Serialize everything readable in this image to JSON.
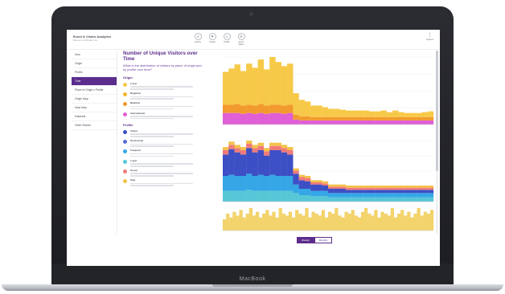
{
  "device": {
    "brand": "MacBook"
  },
  "app": {
    "title": "Event & Visitor Analytics",
    "subtitle": "Museum of Modern Art",
    "toolbar": [
      {
        "label": "History",
        "icon": "history-icon",
        "glyph": "↺"
      },
      {
        "label": "Origins",
        "icon": "flag-icon",
        "glyph": "⚑"
      },
      {
        "label": "Profile",
        "icon": "person-icon",
        "glyph": "♙"
      },
      {
        "label": "Event Matrix",
        "icon": "gear-icon",
        "glyph": "⚙"
      }
    ],
    "menu": {
      "label": "Options",
      "glyph": "⋮"
    }
  },
  "sidebar": {
    "items": [
      {
        "label": "Intro",
        "active": false
      },
      {
        "label": "Origin",
        "active": false
      },
      {
        "label": "Profile",
        "active": false
      },
      {
        "label": "Time",
        "active": true
      },
      {
        "label": "Place of Origin x Profile",
        "active": false
      },
      {
        "label": "Origin Map",
        "active": false
      },
      {
        "label": "Heat Map",
        "active": false
      },
      {
        "label": "Datasets",
        "active": false
      },
      {
        "label": "Other Stories",
        "active": false
      }
    ]
  },
  "content": {
    "title": "Number of Unique Visitors over Time",
    "question": "What is the distribution of visitors by place of origin and by profile over time?",
    "origin_heading": "Origin",
    "origin_items": [
      {
        "name": "Local",
        "color": "#f7c948"
      },
      {
        "name": "Regional",
        "color": "#f5b731"
      },
      {
        "name": "National",
        "color": "#f29a2e"
      },
      {
        "name": "International",
        "color": "#e05fd6"
      }
    ],
    "profile_heading": "Profile",
    "profile_items": [
      {
        "name": "Visitor",
        "color": "#3d4fc4"
      },
      {
        "name": "Occasional",
        "color": "#5a6ed8"
      },
      {
        "name": "Frequent",
        "color": "#35a6e6"
      },
      {
        "name": "Loyal",
        "color": "#56c7d6"
      },
      {
        "name": "Group",
        "color": "#f07a7a"
      },
      {
        "name": "Stay",
        "color": "#f3c24a"
      }
    ]
  },
  "toggle": {
    "options": [
      "Weekly",
      "Monthly"
    ],
    "selected": "Weekly"
  },
  "chart_data": [
    {
      "type": "bar",
      "title": "",
      "stacked": true,
      "categories_count": 36,
      "series": [
        {
          "name": "International",
          "color": "#e05fd6",
          "values": [
            14,
            14,
            14,
            13,
            14,
            13,
            14,
            13,
            14,
            14,
            13,
            14,
            6,
            5,
            5,
            5,
            5,
            5,
            5,
            5,
            5,
            5,
            5,
            5,
            5,
            5,
            5,
            5,
            5,
            5,
            5,
            5,
            5,
            5,
            5,
            5
          ]
        },
        {
          "name": "National",
          "color": "#f29a2e",
          "values": [
            10,
            10,
            11,
            10,
            10,
            10,
            11,
            10,
            10,
            10,
            10,
            10,
            6,
            5,
            5,
            4,
            4,
            4,
            4,
            4,
            4,
            4,
            4,
            4,
            4,
            4,
            4,
            4,
            4,
            4,
            4,
            4,
            4,
            4,
            4,
            4
          ]
        },
        {
          "name": "Local",
          "color": "#f7c948",
          "values": [
            40,
            44,
            48,
            42,
            50,
            46,
            54,
            44,
            58,
            52,
            48,
            50,
            26,
            20,
            18,
            14,
            14,
            12,
            10,
            10,
            9,
            8,
            8,
            8,
            8,
            7,
            7,
            8,
            6,
            8,
            6,
            5,
            5,
            5,
            6,
            7
          ]
        }
      ]
    },
    {
      "type": "bar",
      "title": "",
      "stacked": true,
      "categories_count": 36,
      "series": [
        {
          "name": "Loyal",
          "color": "#56c7d6",
          "values": [
            10,
            10,
            10,
            10,
            11,
            10,
            10,
            10,
            10,
            10,
            10,
            10,
            8,
            6,
            6,
            5,
            5,
            5,
            4,
            4,
            4,
            4,
            4,
            4,
            4,
            4,
            4,
            4,
            4,
            4,
            4,
            4,
            4,
            4,
            4,
            4
          ]
        },
        {
          "name": "Frequent",
          "color": "#35a6e6",
          "values": [
            14,
            15,
            14,
            14,
            15,
            14,
            15,
            14,
            15,
            14,
            14,
            14,
            8,
            6,
            6,
            5,
            5,
            5,
            4,
            4,
            4,
            4,
            4,
            4,
            4,
            4,
            4,
            4,
            4,
            4,
            4,
            4,
            4,
            4,
            4,
            4
          ]
        },
        {
          "name": "Visitor",
          "color": "#3d4fc4",
          "values": [
            20,
            24,
            22,
            20,
            24,
            22,
            23,
            19,
            23,
            24,
            22,
            20,
            10,
            8,
            7,
            6,
            6,
            5,
            4,
            4,
            4,
            3,
            3,
            3,
            3,
            3,
            3,
            3,
            3,
            3,
            3,
            3,
            3,
            3,
            3,
            3
          ]
        },
        {
          "name": "Group",
          "color": "#f07a7a",
          "values": [
            4,
            4,
            4,
            4,
            4,
            4,
            4,
            4,
            4,
            4,
            4,
            4,
            3,
            3,
            3,
            2,
            2,
            2,
            2,
            2,
            2,
            2,
            2,
            2,
            2,
            2,
            2,
            2,
            2,
            2,
            2,
            2,
            2,
            2,
            2,
            2
          ]
        },
        {
          "name": "Stay",
          "color": "#f3c24a",
          "values": [
            3,
            3,
            3,
            3,
            3,
            3,
            3,
            3,
            3,
            3,
            3,
            3,
            2,
            2,
            2,
            2,
            2,
            2,
            2,
            2,
            2,
            2,
            2,
            2,
            2,
            2,
            2,
            2,
            2,
            2,
            2,
            2,
            2,
            2,
            2,
            2
          ]
        }
      ]
    },
    {
      "type": "bar",
      "title": "",
      "stacked": false,
      "categories_count": 64,
      "series": [
        {
          "name": "",
          "color": "#f3d36b",
          "values": [
            6,
            9,
            7,
            10,
            8,
            11,
            7,
            9,
            12,
            8,
            10,
            7,
            9,
            11,
            8,
            10,
            7,
            12,
            9,
            8,
            10,
            7,
            11,
            9,
            8,
            12,
            7,
            10,
            9,
            8,
            11,
            7,
            10,
            9,
            12,
            8,
            7,
            10,
            9,
            11,
            8,
            7,
            10,
            12,
            9,
            8,
            11,
            7,
            10,
            9,
            8,
            12,
            7,
            9,
            11,
            8,
            10,
            7,
            9,
            12,
            8,
            10,
            9,
            11
          ]
        }
      ]
    }
  ]
}
